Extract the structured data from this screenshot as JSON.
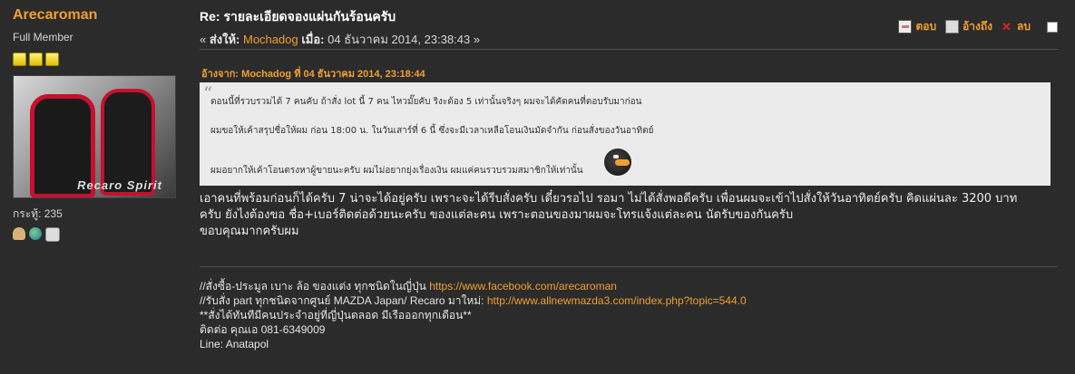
{
  "author": {
    "name": "Arecaroman",
    "rank": "Full Member",
    "stars": 3,
    "avatar_text": "Recaro Spirit",
    "posts": "กระทู้: 235"
  },
  "post": {
    "subject": "Re: รายละเอียดจองแผ่นกันร้อนครับ",
    "meta_prefix": "« ",
    "meta_reply_to": "ส่งให้:",
    "meta_user": "Mochadog",
    "meta_when_label": "เมื่อ:",
    "meta_when": "04 ธันวาคม 2014, 23:38:43 »",
    "actions": {
      "reply": "ตอบ",
      "quote": "อ้างถึง",
      "delete": "ลบ"
    }
  },
  "quote": {
    "header": "อ้างจาก: Mochadog ที่ 04 ธันวาคม 2014, 23:18:44",
    "lines": [
      "ตอนนี้ที่รวบรวมได้ 7 คนคับ ถ้าสั่ง lot นี้ 7 คน ไหวมั๊ยคับ ริงะต้อง 5 เท่านั้นจริงๆ ผมจะได้คัดคนที่ตอบรับมาก่อน",
      "ผมขอให้เค้าสรุปชื่อให้ผม ก่อน 18:00 น. ในวันเสาร์ที่ 6 นี้ ซึ่งจะมีเวลาเหลือโอนเงินมัดจำกัน ก่อนสั่งของวันอาทิตย์",
      "ผมอยากให้เค้าโอนตรงหาผู้ขายนะครับ ผมไม่อยากยุ่งเรื่องเงิน ผมแค่คนรวบรวมสมาชิกให้เท่านั้น"
    ]
  },
  "body": {
    "lines": [
      "เอาคนที่พร้อมก่อนก็ได้ครับ 7 น่าจะได้อยู่ครับ เพราะจะได้รีบสั่งครับ เดี๋ยวรอไป รอมา ไม่ได้สั่งพอดีครับ เพื่อนผมจะเข้าไปสั่งให้วันอาทิตย์ครับ คิดแผ่นละ 3200 บาท",
      "ครับ ยังไงต้องขอ ชื่อ+เบอร์ติดต่อด้วยนะครับ ของแต่ละคน เพราะตอนของมาผมจะโทรแจ้งแต่ละคน นัดรับของกันครับ",
      "ขอบคุณมากครับผม"
    ]
  },
  "signature": {
    "line1_text": "//สั่งซื้อ-ประมูล เบาะ ล้อ ของแต่ง ทุกชนิดในญี่ปุ่น ",
    "line1_url": "https://www.facebook.com/arecaroman",
    "line2_text": "//รับสั่ง part ทุกชนิดจากศูนย์ MAZDA Japan/ Recaro มาใหม่: ",
    "line2_url": "http://www.allnewmazda3.com/index.php?topic=544.0",
    "line3": "**สั่งได้ทันทีมีคนประจำอยู่ที่ญี่ปุ่นตลอด มีเรือออกทุกเดือน**",
    "line4": "ติดต่อ คุณเอ 081-6349009",
    "line5": "Line: Anatapol"
  },
  "colors": {
    "accent": "#f0a030",
    "background": "#2b2b2b",
    "quote_bg": "#ebebeb"
  }
}
